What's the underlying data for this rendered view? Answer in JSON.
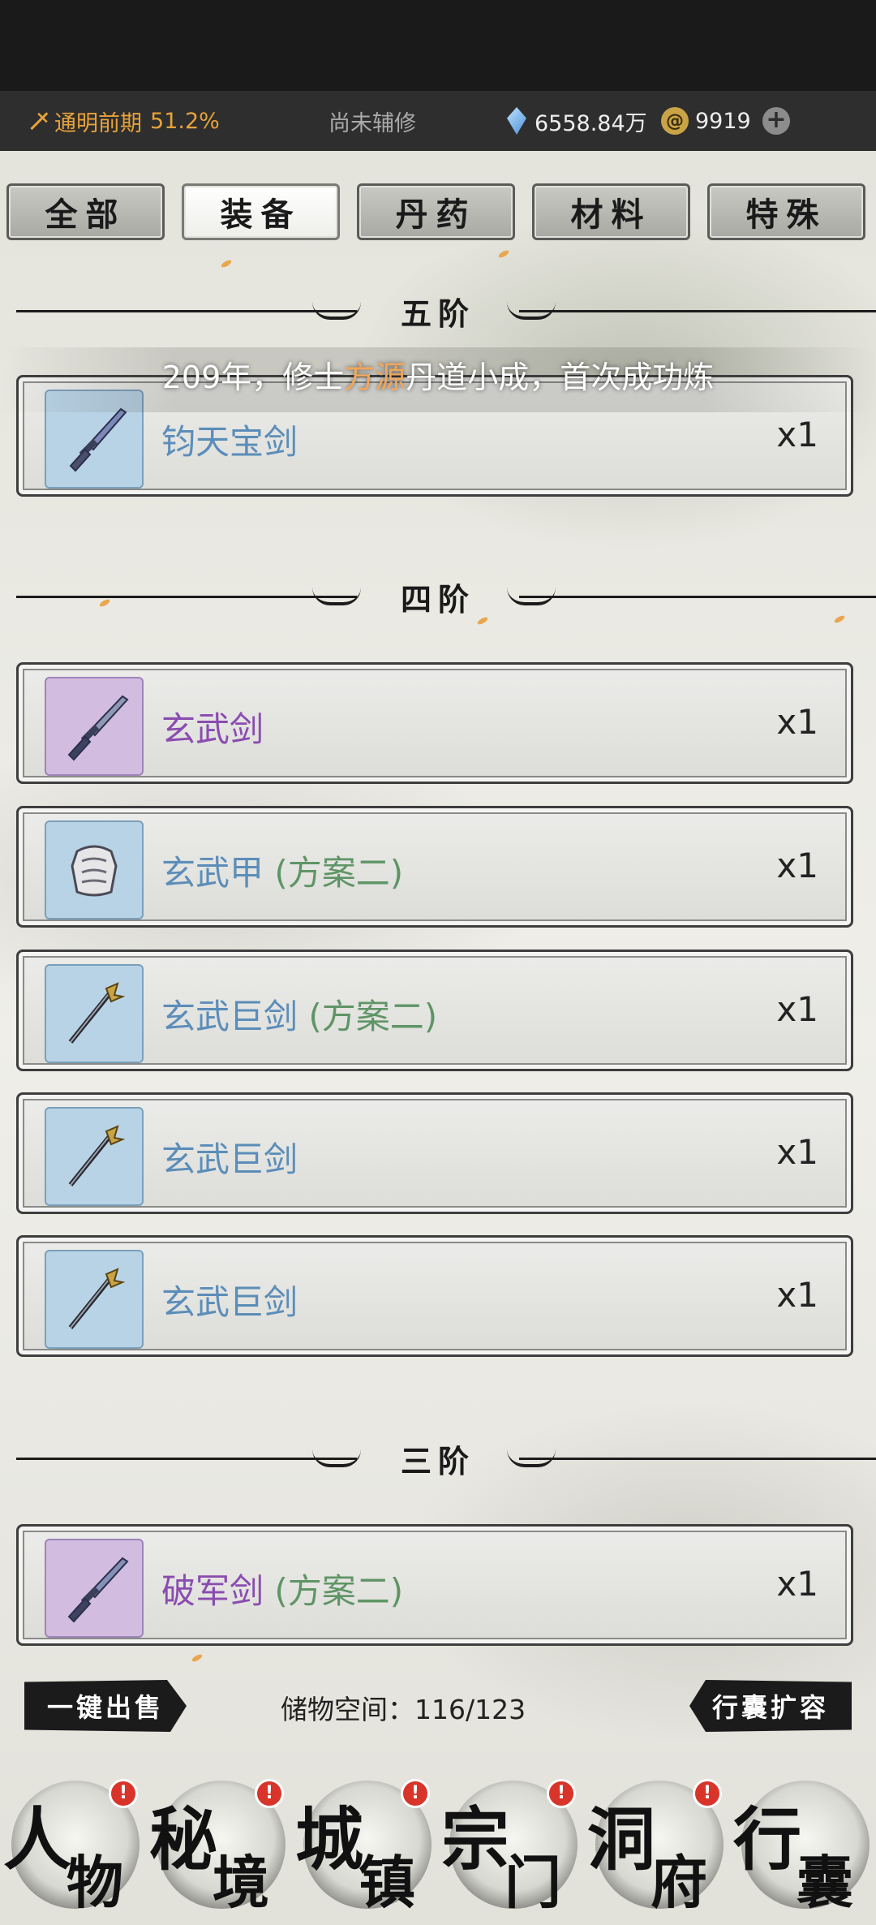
{
  "status": {
    "realm": "通明前期",
    "realm_progress": "51.2%",
    "assist": "尚未辅修",
    "spirit_stones": "6558.84万",
    "coins": "9919"
  },
  "tabs": [
    {
      "label": "全部",
      "active": false
    },
    {
      "label": "装备",
      "active": true
    },
    {
      "label": "丹药",
      "active": false
    },
    {
      "label": "材料",
      "active": false
    },
    {
      "label": "特殊",
      "active": false
    }
  ],
  "notice": {
    "pre": "209年，修士",
    "name": "方源",
    "post": "丹道小成，首次成功炼"
  },
  "tiers": {
    "t5": "五阶",
    "t4": "四阶",
    "t3": "三阶"
  },
  "items": [
    {
      "name": "钧天宝剑",
      "variant": "",
      "qty": "x1",
      "rarity": "blue"
    },
    {
      "name": "玄武剑",
      "variant": "",
      "qty": "x1",
      "rarity": "purple"
    },
    {
      "name": "玄武甲",
      "variant": "(方案二)",
      "qty": "x1",
      "rarity": "blue"
    },
    {
      "name": "玄武巨剑",
      "variant": "(方案二)",
      "qty": "x1",
      "rarity": "blue"
    },
    {
      "name": "玄武巨剑",
      "variant": "",
      "qty": "x1",
      "rarity": "blue"
    },
    {
      "name": "玄武巨剑",
      "variant": "",
      "qty": "x1",
      "rarity": "blue"
    },
    {
      "name": "破军剑",
      "variant": "(方案二)",
      "qty": "x1",
      "rarity": "purple"
    }
  ],
  "bottom": {
    "sell_all": "一键出售",
    "storage": "储物空间：116/123",
    "expand": "行囊扩容"
  },
  "nav": [
    {
      "a": "人",
      "b": "物",
      "badge": "!"
    },
    {
      "a": "秘",
      "b": "境",
      "badge": "!"
    },
    {
      "a": "城",
      "b": "镇",
      "badge": "!"
    },
    {
      "a": "宗",
      "b": "门",
      "badge": "!"
    },
    {
      "a": "洞",
      "b": "府",
      "badge": "!"
    },
    {
      "a": "行",
      "b": "囊",
      "badge": ""
    }
  ],
  "colors": {
    "rarity_blue": "#5b8db9",
    "rarity_purple": "#8a4cb0",
    "variant_green": "#5f9566",
    "highlight_orange": "#f3a65a"
  }
}
